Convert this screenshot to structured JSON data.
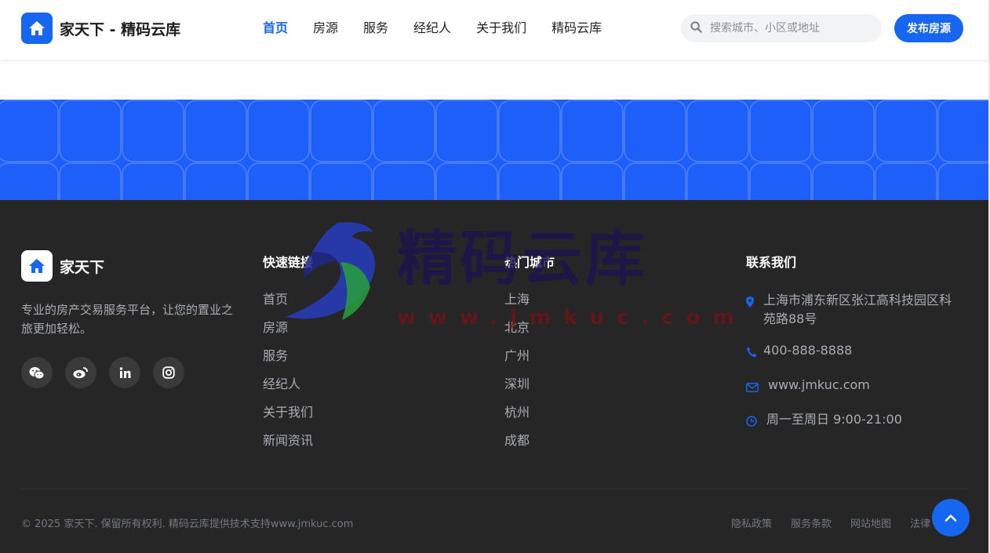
{
  "header": {
    "logo_text": "家天下 - 精码云库",
    "nav": [
      "首页",
      "房源",
      "服务",
      "经纪人",
      "关于我们",
      "精码云库"
    ],
    "active_nav": "首页",
    "search_placeholder": "搜索城市、小区或地址",
    "publish_label": "发布房源"
  },
  "footer": {
    "brand": "家天下",
    "description": "专业的房产交易服务平台，让您的置业之旅更加轻松。",
    "socials": [
      "wechat-icon",
      "weibo-icon",
      "linkedin-icon",
      "instagram-icon"
    ],
    "quick_links": {
      "title": "快速链接",
      "items": [
        "首页",
        "房源",
        "服务",
        "经纪人",
        "关于我们",
        "新闻资讯"
      ]
    },
    "hot_cities": {
      "title": "热门城市",
      "items": [
        "上海",
        "北京",
        "广州",
        "深圳",
        "杭州",
        "成都"
      ]
    },
    "contact": {
      "title": "联系我们",
      "address": "上海市浦东新区张江高科技园区科苑路88号",
      "phone": "400-888-8888",
      "website": "www.jmkuc.com",
      "hours": "周一至周日 9:00-21:00"
    },
    "copyright": "© 2025 家天下. 保留所有权利. 精码云库提供技术支持www.jmkuc.com",
    "bottom_links": [
      "隐私政策",
      "服务条款",
      "网站地图",
      "法律"
    ]
  },
  "watermark": {
    "main": "精码云库",
    "url": "www.jmkuc.com"
  },
  "colors": {
    "accent": "#1666f0",
    "band": "#1d5ff8",
    "footer_bg": "#262626"
  }
}
